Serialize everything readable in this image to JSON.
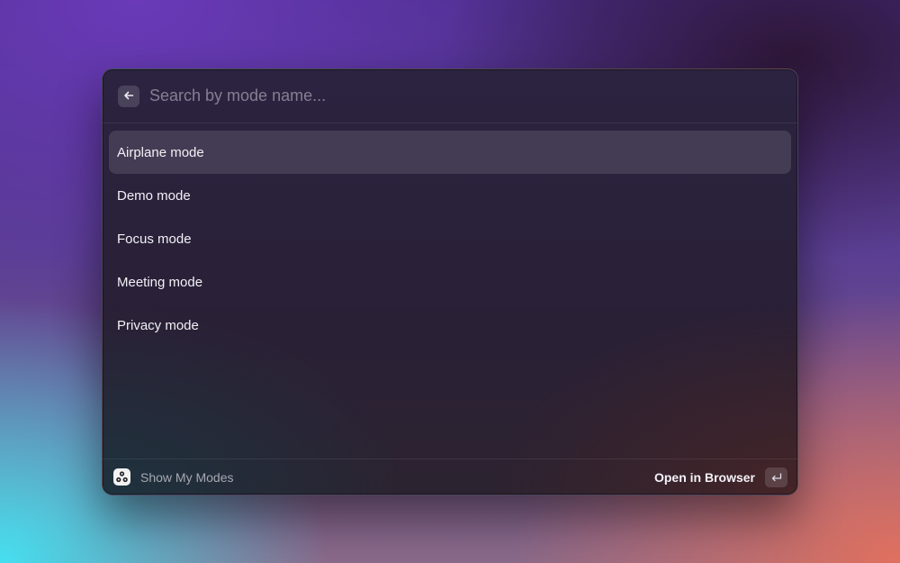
{
  "search": {
    "placeholder": "Search by mode name...",
    "value": "",
    "back_icon": "arrow-left-icon"
  },
  "modes": [
    {
      "label": "Airplane mode",
      "selected": true
    },
    {
      "label": "Demo mode",
      "selected": false
    },
    {
      "label": "Focus mode",
      "selected": false
    },
    {
      "label": "Meeting mode",
      "selected": false
    },
    {
      "label": "Privacy mode",
      "selected": false
    }
  ],
  "footer": {
    "title": "Show My Modes",
    "app_icon": "modes-app-icon",
    "action_label": "Open in Browser",
    "action_key_icon": "return-key-icon"
  },
  "colors": {
    "window_bg": "#2a2036",
    "selected_bg": "rgba(255,255,255,0.12)",
    "text": "#f2f0f6"
  }
}
